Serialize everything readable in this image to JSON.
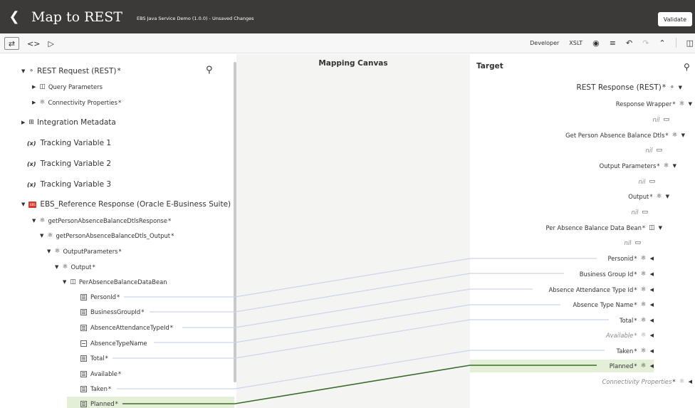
{
  "header": {
    "back_icon": "chevron-left-icon",
    "title": "Map to REST",
    "subtitle": "EBS Java Service Demo (1.0.0) - Unsaved Changes",
    "validate_label": "Validate"
  },
  "toolbar": {
    "developer": "Developer",
    "xslt": "XSLT"
  },
  "canvas": {
    "title": "Mapping Canvas"
  },
  "source": {
    "rest_request": "REST Request (REST)",
    "query_params": "Query Parameters",
    "connectivity": "Connectivity Properties",
    "integration_metadata": "Integration Metadata",
    "tracking1": "Tracking Variable 1",
    "tracking2": "Tracking Variable 2",
    "tracking3": "Tracking Variable 3",
    "ebs_response": "EBS_Reference Response (Oracle E-Business Suite)",
    "ebs_badge": "EBS",
    "get_resp": "getPersonAbsenceBalanceDtlsResponse",
    "get_output": "getPersonAbsenceBalanceDtls_Output",
    "output_params": "OutputParameters",
    "output": "Output",
    "bean": "PerAbsenceBalanceDataBean",
    "fields": [
      "PersonId",
      "BusinessGroupId",
      "AbsenceAttendanceTypeId",
      "AbsenceTypeName",
      "Total",
      "Available",
      "Taken",
      "Planned"
    ]
  },
  "target": {
    "title": "Target",
    "rest_response": "REST Response (REST)",
    "wrapper": "Response Wrapper",
    "nil": "nil",
    "get_dtls": "Get Person Absence Balance Dtls",
    "output_params": "Output Parameters",
    "output": "Output",
    "bean": "Per Absence Balance Data Bean",
    "fields": [
      "Personid",
      "Business Group Id",
      "Absence Attendance Type Id",
      "Absence Type Name",
      "Total",
      "Available",
      "Taken",
      "Planned"
    ],
    "connectivity": "Connectivity Properties"
  },
  "star": "*"
}
